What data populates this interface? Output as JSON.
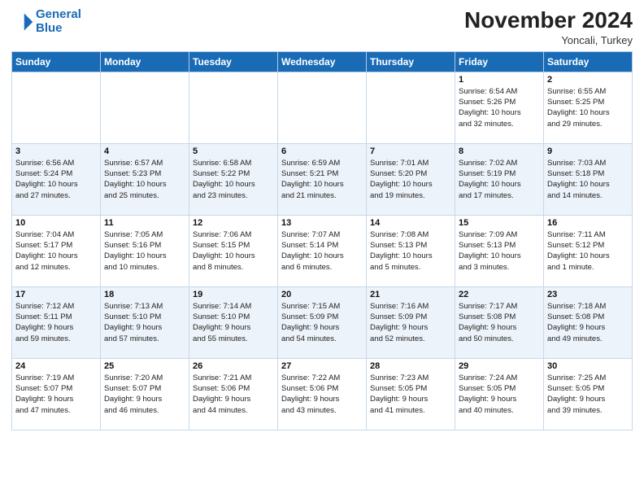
{
  "header": {
    "logo_line1": "General",
    "logo_line2": "Blue",
    "month": "November 2024",
    "location": "Yoncali, Turkey"
  },
  "weekdays": [
    "Sunday",
    "Monday",
    "Tuesday",
    "Wednesday",
    "Thursday",
    "Friday",
    "Saturday"
  ],
  "weeks": [
    [
      {
        "day": "",
        "info": ""
      },
      {
        "day": "",
        "info": ""
      },
      {
        "day": "",
        "info": ""
      },
      {
        "day": "",
        "info": ""
      },
      {
        "day": "",
        "info": ""
      },
      {
        "day": "1",
        "info": "Sunrise: 6:54 AM\nSunset: 5:26 PM\nDaylight: 10 hours\nand 32 minutes."
      },
      {
        "day": "2",
        "info": "Sunrise: 6:55 AM\nSunset: 5:25 PM\nDaylight: 10 hours\nand 29 minutes."
      }
    ],
    [
      {
        "day": "3",
        "info": "Sunrise: 6:56 AM\nSunset: 5:24 PM\nDaylight: 10 hours\nand 27 minutes."
      },
      {
        "day": "4",
        "info": "Sunrise: 6:57 AM\nSunset: 5:23 PM\nDaylight: 10 hours\nand 25 minutes."
      },
      {
        "day": "5",
        "info": "Sunrise: 6:58 AM\nSunset: 5:22 PM\nDaylight: 10 hours\nand 23 minutes."
      },
      {
        "day": "6",
        "info": "Sunrise: 6:59 AM\nSunset: 5:21 PM\nDaylight: 10 hours\nand 21 minutes."
      },
      {
        "day": "7",
        "info": "Sunrise: 7:01 AM\nSunset: 5:20 PM\nDaylight: 10 hours\nand 19 minutes."
      },
      {
        "day": "8",
        "info": "Sunrise: 7:02 AM\nSunset: 5:19 PM\nDaylight: 10 hours\nand 17 minutes."
      },
      {
        "day": "9",
        "info": "Sunrise: 7:03 AM\nSunset: 5:18 PM\nDaylight: 10 hours\nand 14 minutes."
      }
    ],
    [
      {
        "day": "10",
        "info": "Sunrise: 7:04 AM\nSunset: 5:17 PM\nDaylight: 10 hours\nand 12 minutes."
      },
      {
        "day": "11",
        "info": "Sunrise: 7:05 AM\nSunset: 5:16 PM\nDaylight: 10 hours\nand 10 minutes."
      },
      {
        "day": "12",
        "info": "Sunrise: 7:06 AM\nSunset: 5:15 PM\nDaylight: 10 hours\nand 8 minutes."
      },
      {
        "day": "13",
        "info": "Sunrise: 7:07 AM\nSunset: 5:14 PM\nDaylight: 10 hours\nand 6 minutes."
      },
      {
        "day": "14",
        "info": "Sunrise: 7:08 AM\nSunset: 5:13 PM\nDaylight: 10 hours\nand 5 minutes."
      },
      {
        "day": "15",
        "info": "Sunrise: 7:09 AM\nSunset: 5:13 PM\nDaylight: 10 hours\nand 3 minutes."
      },
      {
        "day": "16",
        "info": "Sunrise: 7:11 AM\nSunset: 5:12 PM\nDaylight: 10 hours\nand 1 minute."
      }
    ],
    [
      {
        "day": "17",
        "info": "Sunrise: 7:12 AM\nSunset: 5:11 PM\nDaylight: 9 hours\nand 59 minutes."
      },
      {
        "day": "18",
        "info": "Sunrise: 7:13 AM\nSunset: 5:10 PM\nDaylight: 9 hours\nand 57 minutes."
      },
      {
        "day": "19",
        "info": "Sunrise: 7:14 AM\nSunset: 5:10 PM\nDaylight: 9 hours\nand 55 minutes."
      },
      {
        "day": "20",
        "info": "Sunrise: 7:15 AM\nSunset: 5:09 PM\nDaylight: 9 hours\nand 54 minutes."
      },
      {
        "day": "21",
        "info": "Sunrise: 7:16 AM\nSunset: 5:09 PM\nDaylight: 9 hours\nand 52 minutes."
      },
      {
        "day": "22",
        "info": "Sunrise: 7:17 AM\nSunset: 5:08 PM\nDaylight: 9 hours\nand 50 minutes."
      },
      {
        "day": "23",
        "info": "Sunrise: 7:18 AM\nSunset: 5:08 PM\nDaylight: 9 hours\nand 49 minutes."
      }
    ],
    [
      {
        "day": "24",
        "info": "Sunrise: 7:19 AM\nSunset: 5:07 PM\nDaylight: 9 hours\nand 47 minutes."
      },
      {
        "day": "25",
        "info": "Sunrise: 7:20 AM\nSunset: 5:07 PM\nDaylight: 9 hours\nand 46 minutes."
      },
      {
        "day": "26",
        "info": "Sunrise: 7:21 AM\nSunset: 5:06 PM\nDaylight: 9 hours\nand 44 minutes."
      },
      {
        "day": "27",
        "info": "Sunrise: 7:22 AM\nSunset: 5:06 PM\nDaylight: 9 hours\nand 43 minutes."
      },
      {
        "day": "28",
        "info": "Sunrise: 7:23 AM\nSunset: 5:05 PM\nDaylight: 9 hours\nand 41 minutes."
      },
      {
        "day": "29",
        "info": "Sunrise: 7:24 AM\nSunset: 5:05 PM\nDaylight: 9 hours\nand 40 minutes."
      },
      {
        "day": "30",
        "info": "Sunrise: 7:25 AM\nSunset: 5:05 PM\nDaylight: 9 hours\nand 39 minutes."
      }
    ]
  ]
}
